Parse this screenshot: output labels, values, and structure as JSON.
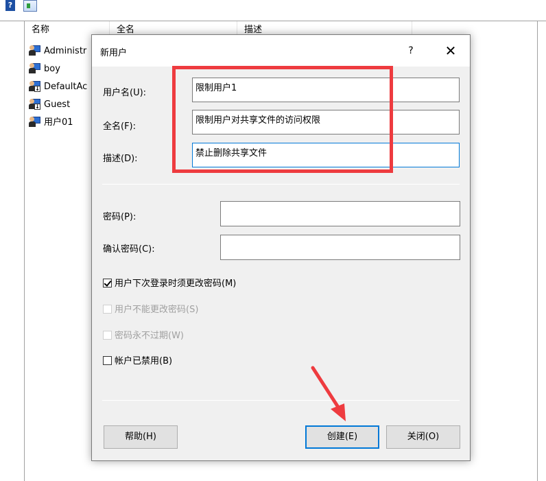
{
  "list": {
    "columns": [
      "名称",
      "全名",
      "描述"
    ],
    "rows": [
      {
        "name": "Administr",
        "disabled": false
      },
      {
        "name": "boy",
        "disabled": false
      },
      {
        "name": "DefaultAc",
        "disabled": true
      },
      {
        "name": "Guest",
        "disabled": true
      },
      {
        "name": "用户01",
        "disabled": false
      }
    ]
  },
  "toolbar": {
    "help_glyph": "?"
  },
  "dialog": {
    "title": "新用户",
    "help_glyph": "?",
    "close_glyph": "✕",
    "fields": {
      "username_label": "用户名(U):",
      "username_value": "限制用户1",
      "fullname_label": "全名(F):",
      "fullname_value": "限制用户对共享文件的访问权限",
      "description_label": "描述(D):",
      "description_value": "禁止删除共享文件",
      "password_label": "密码(P):",
      "confirm_label": "确认密码(C):"
    },
    "checkboxes": {
      "must_change": {
        "label": "用户下次登录时须更改密码(M)",
        "checked": true,
        "enabled": true
      },
      "cannot_change": {
        "label": "用户不能更改密码(S)",
        "checked": false,
        "enabled": false
      },
      "never_expires": {
        "label": "密码永不过期(W)",
        "checked": false,
        "enabled": false
      },
      "disabled": {
        "label": "帐户已禁用(B)",
        "checked": false,
        "enabled": true
      }
    },
    "buttons": {
      "help": "帮助(H)",
      "create": "创建(E)",
      "close": "关闭(O)"
    }
  },
  "colors": {
    "annotation": "#ee3b3f",
    "focus": "#0078d7"
  }
}
